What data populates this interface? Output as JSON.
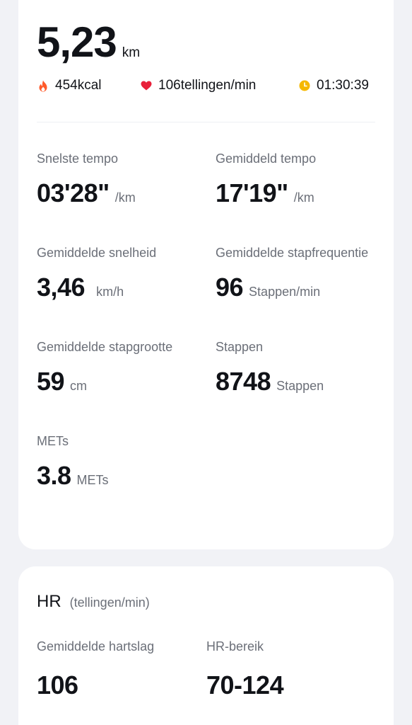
{
  "summary": {
    "distance": {
      "value": "5,23",
      "unit": "km"
    },
    "metrics": {
      "calories": {
        "value": "454kcal",
        "icon": "flame-icon",
        "color": "#ff5a2b"
      },
      "heart_rate": {
        "value": "106tellingen/min",
        "icon": "heart-icon",
        "color": "#e8203a"
      },
      "duration": {
        "value": "01:30:39",
        "icon": "clock-icon",
        "color": "#f5b800"
      }
    },
    "stats": [
      {
        "label": "Snelste tempo",
        "value": "03'28\"",
        "unit": "/km"
      },
      {
        "label": "Gemiddeld tempo",
        "value": "17'19\"",
        "unit": "/km"
      },
      {
        "label": "Gemiddelde snelheid",
        "value": "3,46",
        "unit": "km/h"
      },
      {
        "label": "Gemiddelde stapfrequentie",
        "value": "96",
        "unit": "Stappen/min"
      },
      {
        "label": "Gemiddelde stapgrootte",
        "value": "59",
        "unit": "cm"
      },
      {
        "label": "Stappen",
        "value": "8748",
        "unit": "Stappen"
      },
      {
        "label": "METs",
        "value": "3.8",
        "unit": "METs"
      }
    ]
  },
  "hr_card": {
    "title": "HR",
    "unit": "(tellingen/min)",
    "average": {
      "label": "Gemiddelde hartslag",
      "value": "106"
    },
    "range": {
      "label": "HR-bereik",
      "value": "70-124"
    }
  }
}
